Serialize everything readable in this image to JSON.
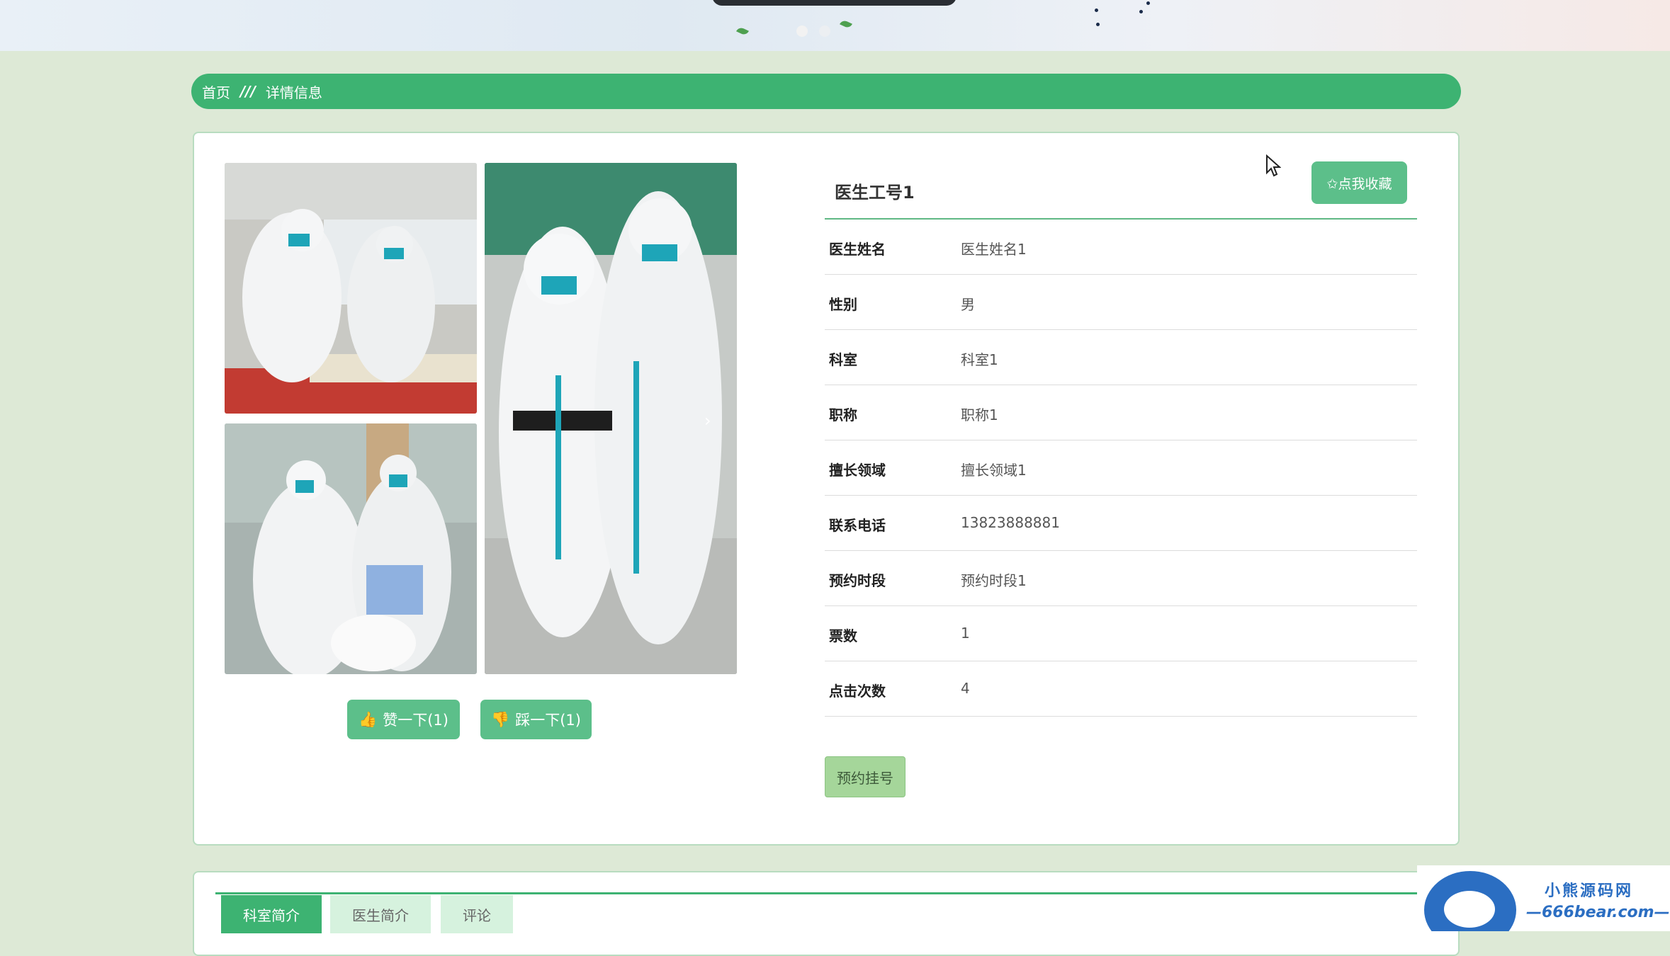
{
  "breadcrumb": {
    "home": "首页",
    "separator": "///",
    "current": "详情信息"
  },
  "detail": {
    "title": "医生工号1",
    "favorite_label": "✩点我收藏",
    "fields": [
      {
        "label": "医生姓名",
        "value": "医生姓名1"
      },
      {
        "label": "性别",
        "value": "男"
      },
      {
        "label": "科室",
        "value": "科室1"
      },
      {
        "label": "职称",
        "value": "职称1"
      },
      {
        "label": "擅长领域",
        "value": "擅长领域1"
      },
      {
        "label": "联系电话",
        "value": "13823888881"
      },
      {
        "label": "预约时段",
        "value": "预约时段1"
      },
      {
        "label": "票数",
        "value": "1"
      },
      {
        "label": "点击次数",
        "value": "4"
      }
    ],
    "book_label": "预约挂号"
  },
  "votes": {
    "like_label": "赞一下(1)",
    "dislike_label": "踩一下(1)"
  },
  "tabs": [
    {
      "label": "科室简介",
      "active": true
    },
    {
      "label": "医生简介",
      "active": false
    },
    {
      "label": "评论",
      "active": false
    }
  ],
  "watermark": {
    "line1": "小熊源码网",
    "line2": "—666bear.com—"
  },
  "colors": {
    "accent": "#3db372",
    "button": "#5cbf8a",
    "book": "#a5d69a"
  }
}
